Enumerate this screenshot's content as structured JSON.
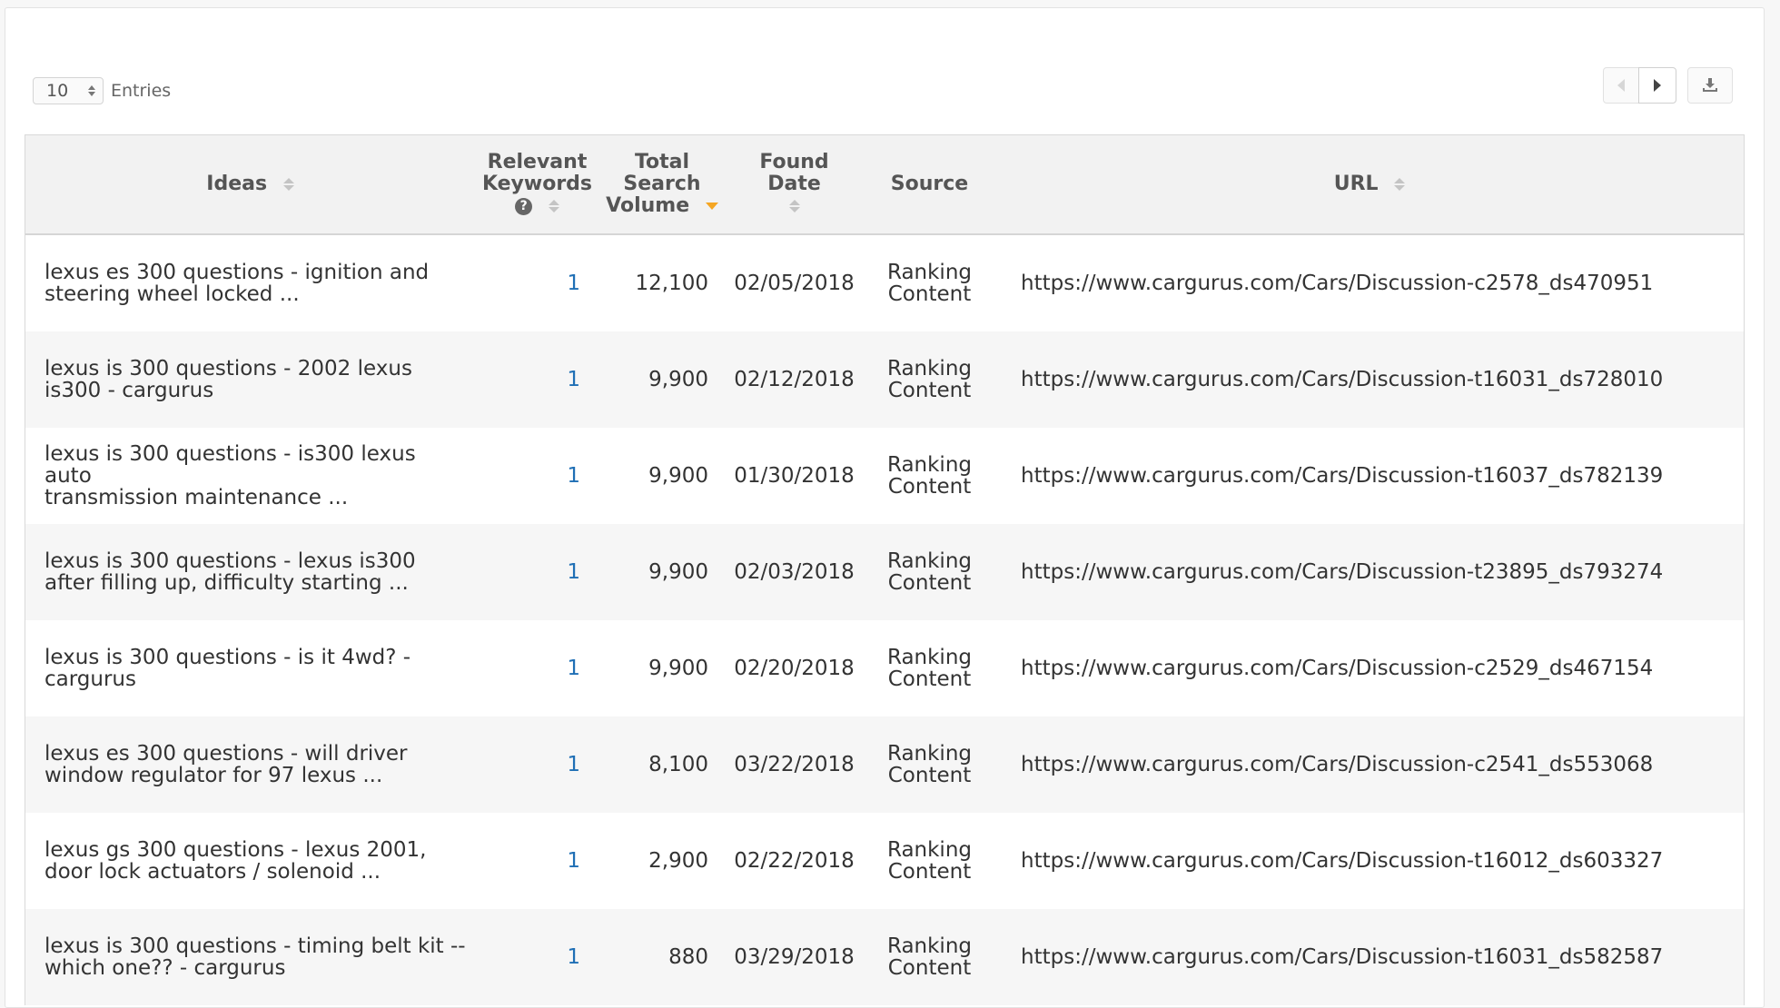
{
  "entries": {
    "value": "10",
    "label": "Entries"
  },
  "columns": {
    "ideas": "Ideas",
    "relevant_keywords_line1": "Relevant",
    "relevant_keywords_line2": "Keywords",
    "help_glyph": "?",
    "total_search_volume_line1": "Total",
    "total_search_volume_line2": "Search",
    "total_search_volume_line3": "Volume",
    "found_date": "Found Date",
    "source": "Source",
    "url": "URL"
  },
  "rows": [
    {
      "idea_line1": "lexus es 300 questions - ignition and",
      "idea_line2": "steering wheel locked ...",
      "keywords": "1",
      "volume": "12,100",
      "date": "02/05/2018",
      "source_line1": "Ranking",
      "source_line2": "Content",
      "url": "https://www.cargurus.com/Cars/Discussion-c2578_ds470951"
    },
    {
      "idea_line1": "lexus is 300 questions - 2002 lexus",
      "idea_line2": "is300 - cargurus",
      "keywords": "1",
      "volume": "9,900",
      "date": "02/12/2018",
      "source_line1": "Ranking",
      "source_line2": "Content",
      "url": "https://www.cargurus.com/Cars/Discussion-t16031_ds728010"
    },
    {
      "idea_line1": "lexus is 300 questions - is300 lexus auto",
      "idea_line2": "transmission maintenance ...",
      "keywords": "1",
      "volume": "9,900",
      "date": "01/30/2018",
      "source_line1": "Ranking",
      "source_line2": "Content",
      "url": "https://www.cargurus.com/Cars/Discussion-t16037_ds782139"
    },
    {
      "idea_line1": "lexus is 300 questions - lexus is300",
      "idea_line2": "after filling up, difficulty starting ...",
      "keywords": "1",
      "volume": "9,900",
      "date": "02/03/2018",
      "source_line1": "Ranking",
      "source_line2": "Content",
      "url": "https://www.cargurus.com/Cars/Discussion-t23895_ds793274"
    },
    {
      "idea_line1": "lexus is 300 questions - is it 4wd? -",
      "idea_line2": "cargurus",
      "keywords": "1",
      "volume": "9,900",
      "date": "02/20/2018",
      "source_line1": "Ranking",
      "source_line2": "Content",
      "url": "https://www.cargurus.com/Cars/Discussion-c2529_ds467154"
    },
    {
      "idea_line1": "lexus es 300 questions - will driver",
      "idea_line2": "window regulator for 97 lexus ...",
      "keywords": "1",
      "volume": "8,100",
      "date": "03/22/2018",
      "source_line1": "Ranking",
      "source_line2": "Content",
      "url": "https://www.cargurus.com/Cars/Discussion-c2541_ds553068"
    },
    {
      "idea_line1": "lexus gs 300 questions - lexus 2001,",
      "idea_line2": "door lock actuators / solenoid ...",
      "keywords": "1",
      "volume": "2,900",
      "date": "02/22/2018",
      "source_line1": "Ranking",
      "source_line2": "Content",
      "url": "https://www.cargurus.com/Cars/Discussion-t16012_ds603327"
    },
    {
      "idea_line1": "lexus is 300 questions - timing belt kit --",
      "idea_line2": "which one?? - cargurus",
      "keywords": "1",
      "volume": "880",
      "date": "03/29/2018",
      "source_line1": "Ranking",
      "source_line2": "Content",
      "url": "https://www.cargurus.com/Cars/Discussion-t16031_ds582587"
    }
  ],
  "icons": {
    "entries_spinner": "up-down-spinner-icon",
    "prev": "triangle-left-icon",
    "next": "triangle-right-icon",
    "download": "download-icon",
    "sort": "sort-updown-icon",
    "sort_active": "sort-desc-icon",
    "help": "question-circle-icon"
  },
  "colors": {
    "keyword_link": "#1f6fb5",
    "sort_active": "#f5a623",
    "header_bg": "#f2f2f2",
    "row_stripe": "#f6f6f6"
  }
}
